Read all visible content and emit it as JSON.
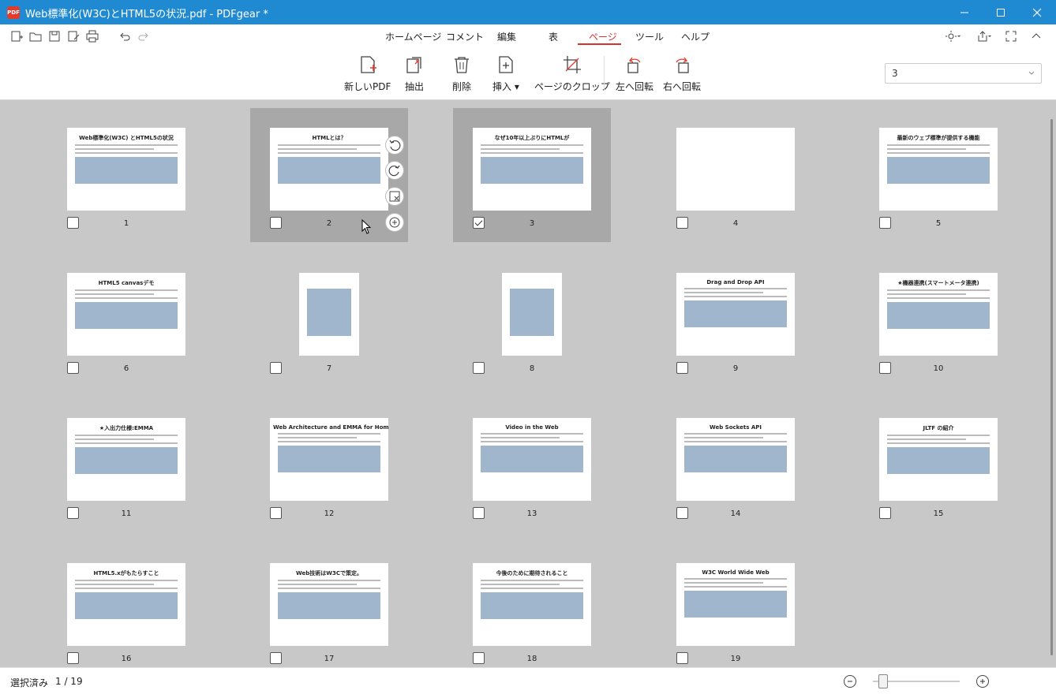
{
  "window": {
    "title": "Web標準化(W3C)とHTML5の状況.pdf - PDFgear *",
    "logo_text": "PDF",
    "controls": [
      "minimize",
      "maximize",
      "close"
    ]
  },
  "menu": {
    "tabs": [
      {
        "label": "ホームページ"
      },
      {
        "label": "コメント"
      },
      {
        "label": "編集"
      },
      {
        "label": "表"
      },
      {
        "label": "ページ",
        "active": true
      },
      {
        "label": "ツール"
      },
      {
        "label": "ヘルプ"
      }
    ]
  },
  "toolbar": {
    "tools": [
      {
        "label": "新しいPDF",
        "icon": "new-pdf-icon"
      },
      {
        "label": "抽出",
        "icon": "extract-icon"
      },
      {
        "label": "削除",
        "icon": "trash-icon"
      },
      {
        "label": "挿入 ▾",
        "icon": "insert-icon"
      },
      {
        "label": "ページのクロップ",
        "icon": "crop-icon"
      },
      {
        "label": "左へ回転",
        "icon": "rotate-left-icon"
      },
      {
        "label": "右へ回転",
        "icon": "rotate-right-icon"
      }
    ],
    "page_select_value": "3"
  },
  "pages": [
    {
      "number": "1",
      "title": "Web標準化(W3C) とHTML5の状況"
    },
    {
      "number": "2",
      "title": "HTMLとは？",
      "highlighted": true
    },
    {
      "number": "3",
      "title": "なぜ10年以上ぶりにHTMLが",
      "highlighted": true,
      "checked": true
    },
    {
      "number": "4",
      "title": ""
    },
    {
      "number": "5",
      "title": "最新のウェブ標準が提供する機能"
    },
    {
      "number": "6",
      "title": "HTML5 canvasデモ"
    },
    {
      "number": "7",
      "title": "",
      "portrait": true
    },
    {
      "number": "8",
      "title": "",
      "portrait": true
    },
    {
      "number": "9",
      "title": "Drag and Drop API"
    },
    {
      "number": "10",
      "title": "★機器連携(スマートメータ連携)"
    },
    {
      "number": "11",
      "title": "★入出力仕様:EMMA"
    },
    {
      "number": "12",
      "title": "Web Architecture and EMMA for Home network"
    },
    {
      "number": "13",
      "title": "Video in the Web"
    },
    {
      "number": "14",
      "title": "Web Sockets API"
    },
    {
      "number": "15",
      "title": "JLTF の紹介"
    },
    {
      "number": "16",
      "title": "HTML5.xがもたらすこと"
    },
    {
      "number": "17",
      "title": "Web技術はW3Cで策定。"
    },
    {
      "number": "18",
      "title": "今後のために期待されること"
    },
    {
      "number": "19",
      "title": "W3C World Wide Web"
    }
  ],
  "status": {
    "label": "選択済み",
    "count": "1 / 19"
  },
  "zoom": {
    "level": 0.1
  }
}
